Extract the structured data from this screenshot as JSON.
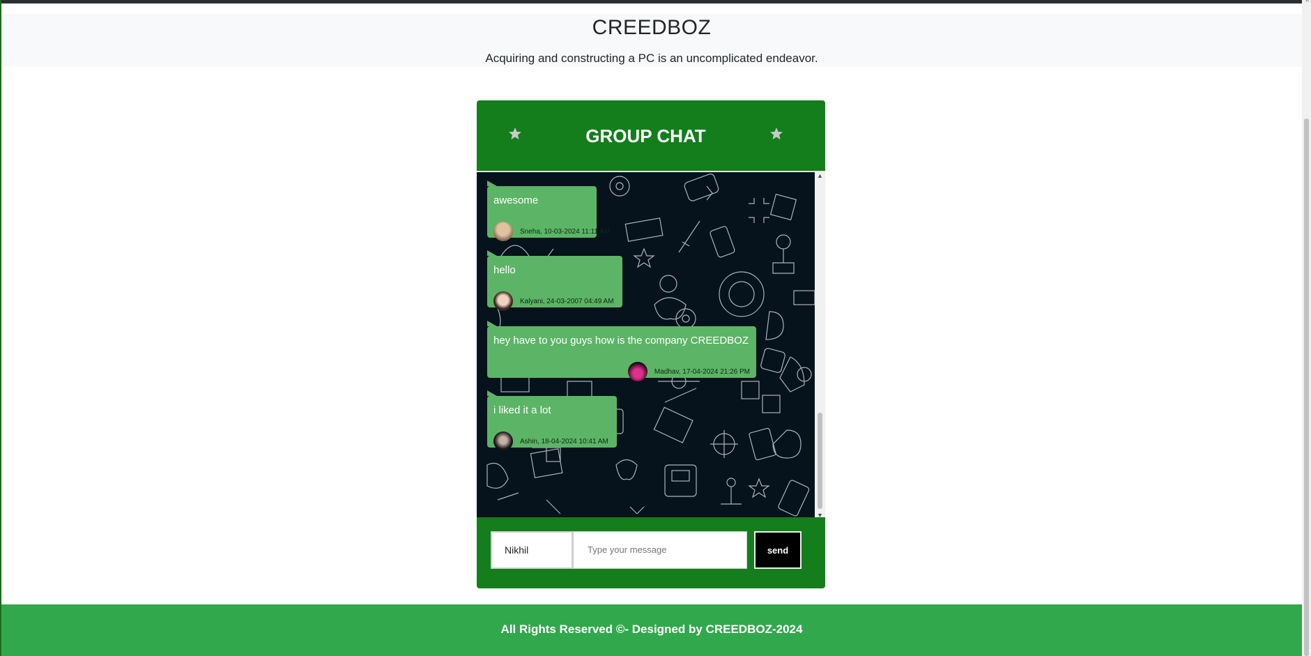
{
  "header": {
    "brand": "CREEDBOZ",
    "tagline": "Acquiring and constructing a PC is an uncomplicated endeavor."
  },
  "chat": {
    "title": "GROUP CHAT",
    "messages": [
      {
        "text": "awesome",
        "meta": "Sneha, 10-03-2024 11:11 AM"
      },
      {
        "text": "hello",
        "meta": "Kalyani, 24-03-2007 04:49 AM"
      },
      {
        "text": "hey have to you guys how is the company CREEDBOZ",
        "meta": "Madhav, 17-04-2024 21:26 PM"
      },
      {
        "text": "i liked it a lot",
        "meta": "Ashin, 18-04-2024 10:41 AM"
      }
    ],
    "name_value": "Nikhil",
    "message_placeholder": "Type your message",
    "send_label": "send"
  },
  "footer": {
    "text": "All Rights Reserved ©- Designed by CREEDBOZ-2024"
  },
  "colors": {
    "chat_green": "#137e1b",
    "bubble_green": "#5cb466",
    "footer_green": "#32a84c"
  }
}
